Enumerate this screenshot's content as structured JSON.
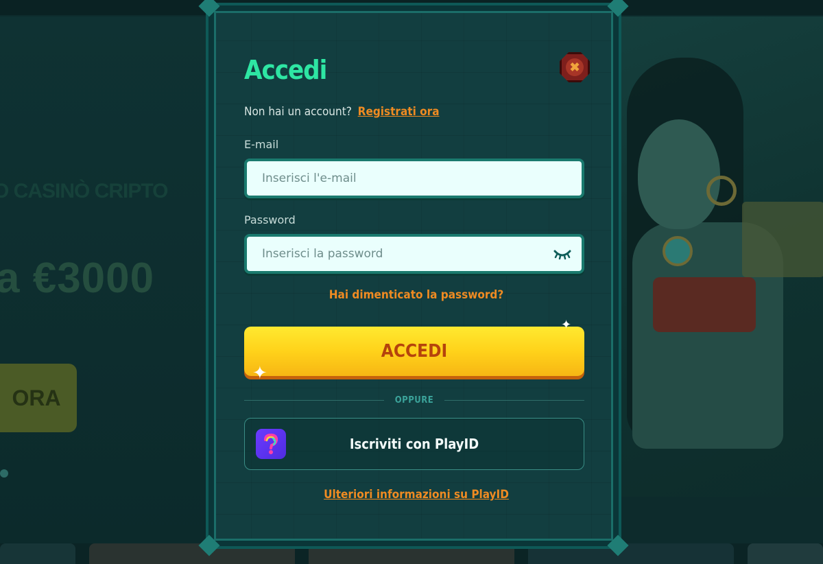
{
  "background": {
    "promo_text": "O CASINÒ CRIPTO",
    "amount_text": "a €3000",
    "cta_text": "ORA"
  },
  "modal": {
    "title": "Accedi",
    "close_icon": "close-icon",
    "signup_prompt": "Non hai un account?",
    "signup_link": "Registrati ora",
    "email_label": "E-mail",
    "email_placeholder": "Inserisci l'e-mail",
    "email_value": "",
    "password_label": "Password",
    "password_placeholder": "Inserisci la password",
    "password_value": "",
    "password_toggle_icon": "eye-closed-icon",
    "forgot_link": "Hai dimenticato la password?",
    "submit_label": "ACCEDI",
    "divider_text": "OPPURE",
    "playid_label": "Iscriviti con PlayID",
    "playid_icon": "playid-logo-icon",
    "playid_info_link": "Ulteriori informazioni su PlayID"
  },
  "colors": {
    "title": "#2ee6a3",
    "link": "#ef8b22",
    "button_gradient_top": "#ffe930",
    "button_text": "#b5430c",
    "modal_bg": "#123e40"
  }
}
